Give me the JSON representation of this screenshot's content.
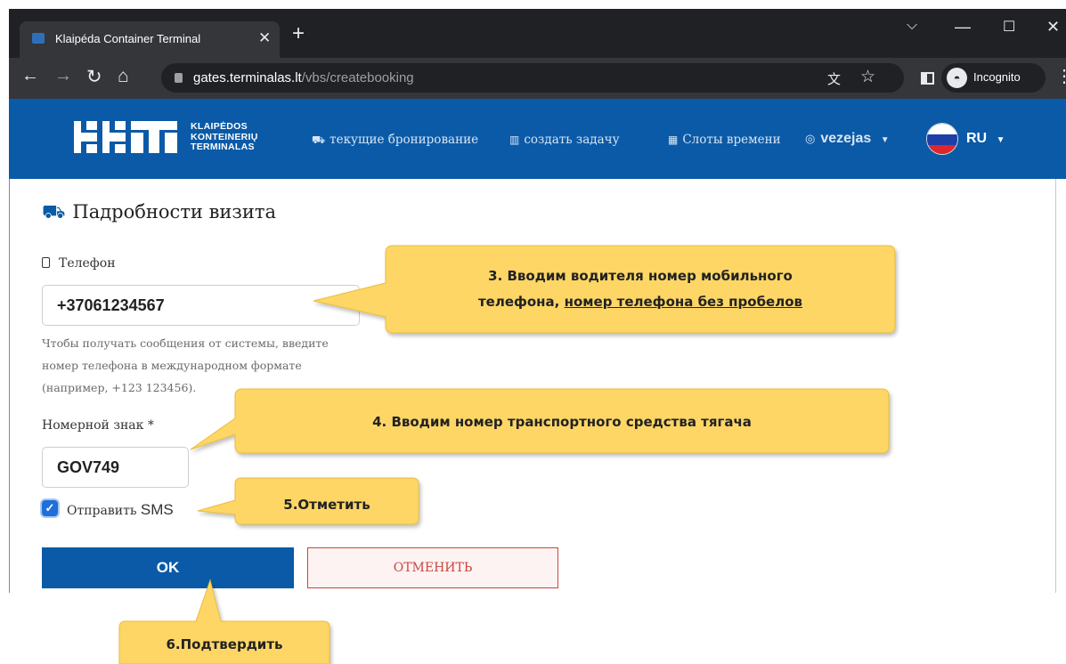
{
  "browser": {
    "tab_title": "Klaipéda Container Terminal",
    "tab_close": "✕",
    "new_tab": "+",
    "url_domain": "gates.terminalas.lt",
    "url_path": "/vbs/createbooking",
    "incognito_label": "Incognito",
    "window_controls": {
      "dropdown": "⌵",
      "minimize": "—",
      "maximize": "☐",
      "close": "✕"
    }
  },
  "header": {
    "logo_lines": [
      "KLAIPĖDOS",
      "KONTEINERIŲ",
      "TERMINALAS"
    ],
    "nav": [
      {
        "label": "текущие бронирование",
        "icon": "truck-icon"
      },
      {
        "label": "создать задачу",
        "icon": "barcode-icon"
      },
      {
        "label": "Слоты времени",
        "icon": "calendar-icon"
      }
    ],
    "user": "vezejas",
    "language": "RU",
    "brand_color": "#0b5aa7"
  },
  "form": {
    "title": "Падробности визита",
    "phone_label": "Телефон",
    "phone_value": "+37061234567",
    "phone_help": "Чтобы получать сообщения от системы, введите номер телефона в международном формате (например, +123 123456).",
    "plate_label": "Номерной знак *",
    "plate_value": "GOV749",
    "sms_label_prefix": "Отправить ",
    "sms_label_sms": "SMS",
    "sms_checked": true,
    "ok_label": "OK",
    "cancel_label": "ОТМЕНИТЬ"
  },
  "callouts": {
    "step3_line1": "3. Вводим водителя номер мобильного",
    "step3_line2_prefix": "телефона, ",
    "step3_line2_underlined": "номер телефона без пробелов",
    "step4": "4. Вводим номер транспортного средства тягача",
    "step5": "5.Отметить",
    "step6": "6.Подтвердить",
    "fill_color": "#fdd666"
  }
}
